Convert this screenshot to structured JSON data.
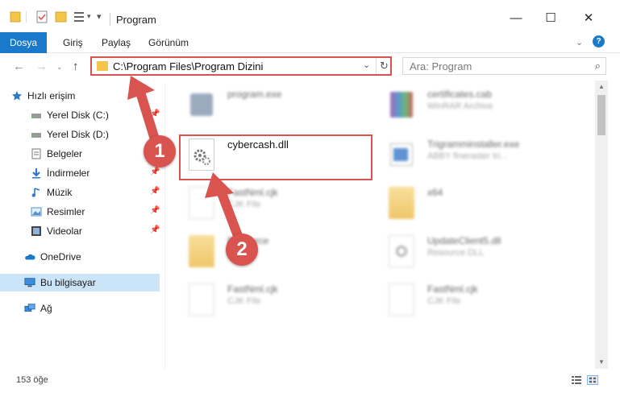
{
  "window": {
    "title": "Program",
    "minimize": "—",
    "maximize": "☐",
    "close": "✕"
  },
  "ribbon": {
    "tabs": [
      "Dosya",
      "Giriş",
      "Paylaş",
      "Görünüm"
    ]
  },
  "address": {
    "path": "C:\\Program Files\\Program Dizini",
    "search_placeholder": "Ara: Program"
  },
  "sidebar": {
    "items": [
      {
        "label": "Hızlı erişim",
        "icon": "star-icon"
      },
      {
        "label": "Yerel Disk (C:)",
        "icon": "drive-icon"
      },
      {
        "label": "Yerel Disk (D:)",
        "icon": "drive-icon"
      },
      {
        "label": "Belgeler",
        "icon": "documents-icon"
      },
      {
        "label": "İndirmeler",
        "icon": "download-icon"
      },
      {
        "label": "Müzik",
        "icon": "music-icon"
      },
      {
        "label": "Resimler",
        "icon": "pictures-icon"
      },
      {
        "label": "Videolar",
        "icon": "video-icon"
      },
      {
        "label": "OneDrive",
        "icon": "cloud-icon"
      },
      {
        "label": "Bu bilgisayar",
        "icon": "computer-icon"
      },
      {
        "label": "Ağ",
        "icon": "network-icon"
      }
    ]
  },
  "files": [
    {
      "name": "program.exe",
      "type": "",
      "icon": "app-icon"
    },
    {
      "name": "certificates.cab",
      "type": "WinRAR Archive",
      "icon": "archive-icon"
    },
    {
      "name": "cybercash.dll",
      "type": "",
      "icon": "dll-gear-icon"
    },
    {
      "name": "Trigramminstaller.exe",
      "type": "ABBY fineraster tri...",
      "icon": "installer-icon"
    },
    {
      "name": "FastNml.cjk",
      "type": "CJK File",
      "icon": "document-icon"
    },
    {
      "name": "x64",
      "type": "",
      "icon": "folder-icon"
    },
    {
      "name": "Resource",
      "type": "",
      "icon": "folder-icon"
    },
    {
      "name": "UpdateClient5.dll",
      "type": "Resource DLL",
      "icon": "dll-icon"
    },
    {
      "name": "FastNml.cjk",
      "type": "CJK File",
      "icon": "document-icon"
    },
    {
      "name": "FastNml.cjk",
      "type": "CJK File",
      "icon": "document-icon"
    }
  ],
  "status": {
    "count": "153 öğe"
  },
  "callouts": {
    "first": "1",
    "second": "2"
  },
  "colors": {
    "accent": "#1979ca",
    "highlight": "#d9534f",
    "selected": "#cce4f7",
    "folder": "#f4c54a"
  }
}
